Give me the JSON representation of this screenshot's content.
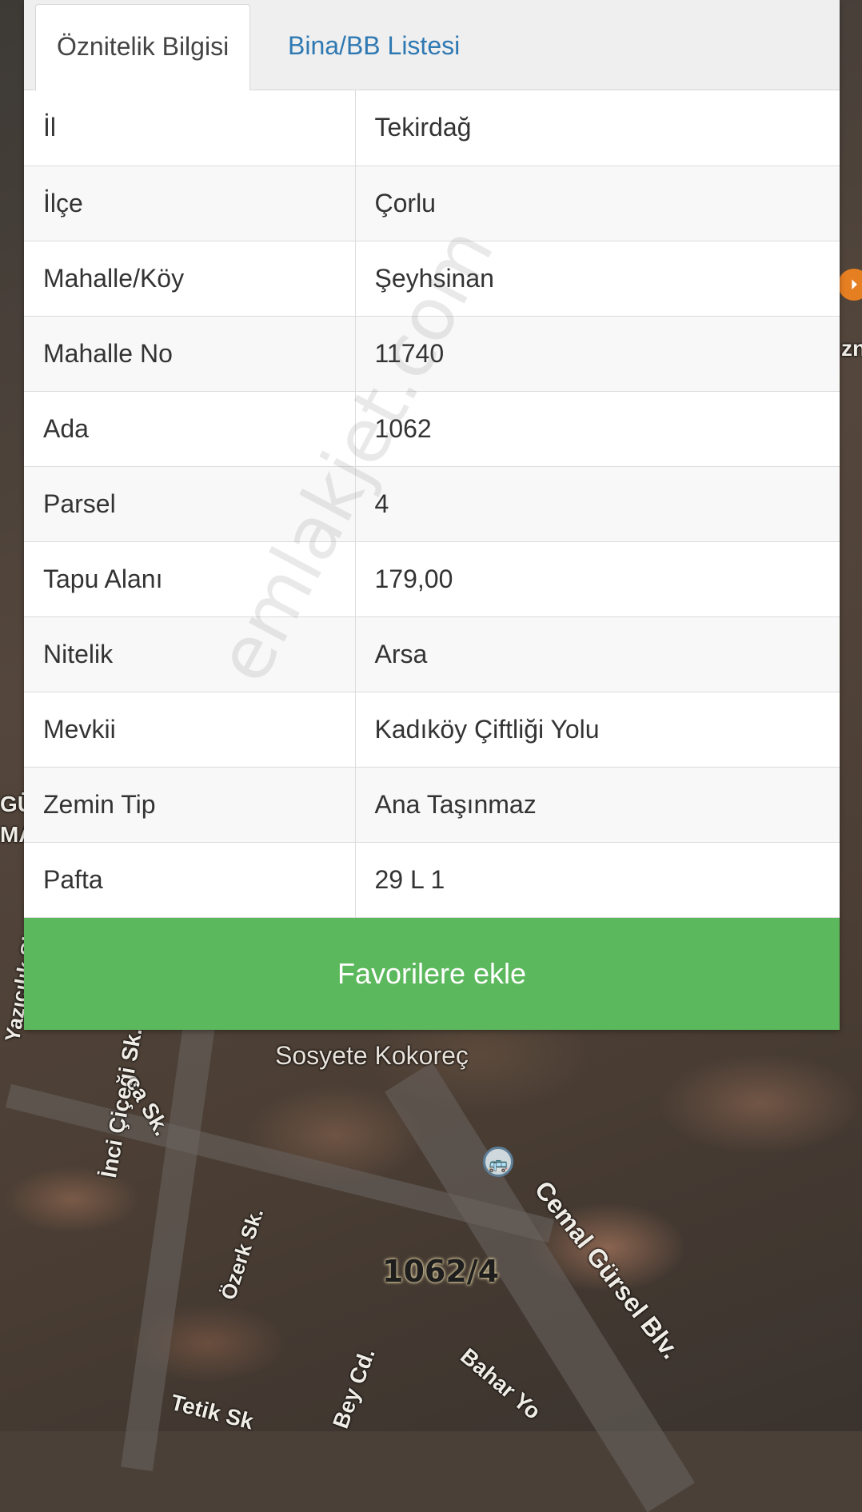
{
  "tabs": {
    "active": "Öznitelik Bilgisi",
    "inactive": "Bina/BB Listesi"
  },
  "attributes": [
    {
      "key": "İl",
      "value": "Tekirdağ"
    },
    {
      "key": "İlçe",
      "value": "Çorlu"
    },
    {
      "key": "Mahalle/Köy",
      "value": "Şeyhsinan"
    },
    {
      "key": "Mahalle No",
      "value": "11740"
    },
    {
      "key": "Ada",
      "value": "1062"
    },
    {
      "key": "Parsel",
      "value": "4"
    },
    {
      "key": "Tapu Alanı",
      "value": "179,00"
    },
    {
      "key": "Nitelik",
      "value": "Arsa"
    },
    {
      "key": "Mevkii",
      "value": "Kadıköy Çiftliği Yolu"
    },
    {
      "key": "Zemin Tip",
      "value": "Ana Taşınmaz"
    },
    {
      "key": "Pafta",
      "value": "29 L 1"
    }
  ],
  "favorite_button": "Favorilere ekle",
  "watermark": "emlakjet.com",
  "map": {
    "parcel_label": "1062/4",
    "poi_label": "Sosyete Kokoreç",
    "streets": [
      "İnci Çiçeği Sk.",
      "Özerk Sk.",
      "Cemal Gürsel Blv.",
      "Bahar Yo",
      "Bey Cd.",
      "Tetik Sk",
      "ca Sk.",
      "Yazıcılık Sk."
    ],
    "edge_fragments": [
      "zn",
      "GÜ",
      "MA"
    ]
  },
  "colors": {
    "accent_green": "#5cb85c",
    "tab_link_blue": "#2f79b3"
  }
}
